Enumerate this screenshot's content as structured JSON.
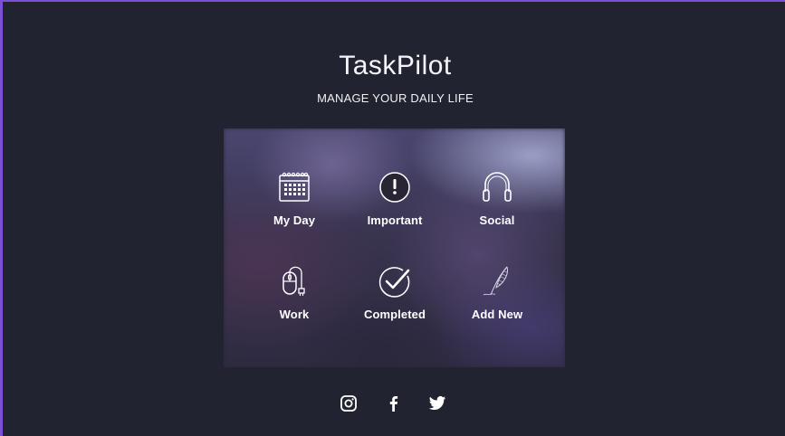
{
  "header": {
    "title": "TaskPilot",
    "subtitle": "MANAGE YOUR DAILY LIFE"
  },
  "menu": {
    "tiles": [
      {
        "label": "My Day",
        "icon": "calendar-icon"
      },
      {
        "label": "Important",
        "icon": "exclamation-icon"
      },
      {
        "label": "Social",
        "icon": "headphones-icon"
      },
      {
        "label": "Work",
        "icon": "computer-mouse-icon"
      },
      {
        "label": "Completed",
        "icon": "checkmark-icon"
      },
      {
        "label": "Add New",
        "icon": "feather-pen-icon"
      }
    ]
  },
  "social_links": [
    {
      "icon": "instagram-icon"
    },
    {
      "icon": "facebook-icon"
    },
    {
      "icon": "twitter-icon"
    }
  ],
  "colors": {
    "background": "#222330",
    "accent_border": "#7b4fd6",
    "text": "#ffffff"
  }
}
